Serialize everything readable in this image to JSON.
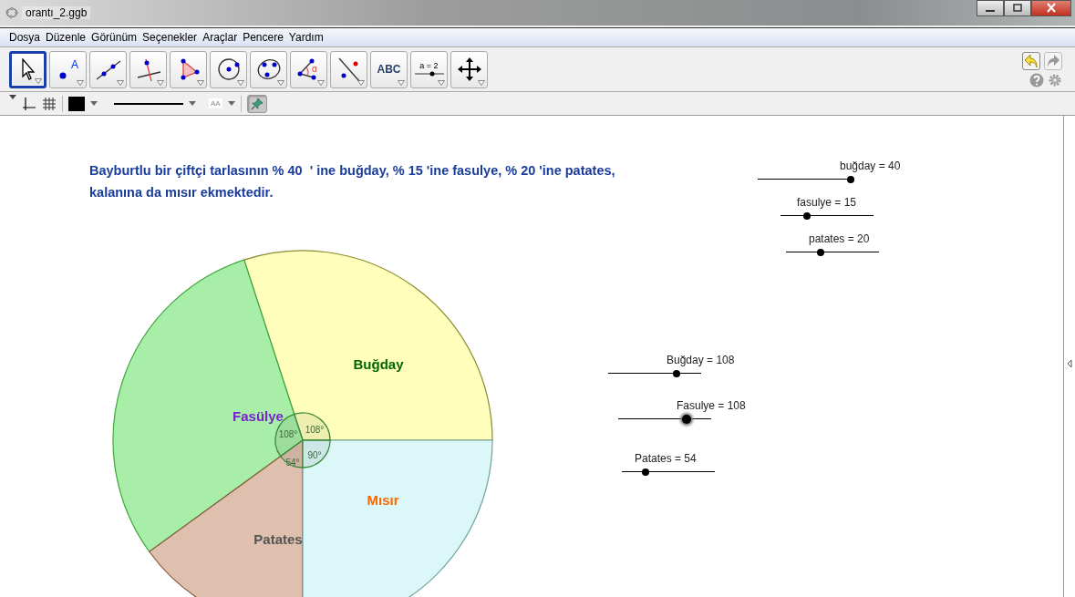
{
  "window": {
    "title": "orantı_2.ggb"
  },
  "menu": [
    "Dosya",
    "Düzenle",
    "Görünüm",
    "Seçenekler",
    "Araçlar",
    "Pencere",
    "Yardım"
  ],
  "tools": [
    {
      "kind": "move",
      "selected": true
    },
    {
      "kind": "point",
      "label": "A",
      "selected": false
    },
    {
      "kind": "line",
      "selected": false
    },
    {
      "kind": "perpendicular",
      "selected": false
    },
    {
      "kind": "polygon",
      "selected": false
    },
    {
      "kind": "circle",
      "selected": false
    },
    {
      "kind": "conic",
      "selected": false
    },
    {
      "kind": "angle",
      "label": "α",
      "selected": false
    },
    {
      "kind": "reflect",
      "selected": false
    },
    {
      "kind": "text",
      "label": "ABC",
      "selected": false
    },
    {
      "kind": "slider",
      "label": "a = 2",
      "selected": false
    },
    {
      "kind": "move-view",
      "selected": false
    }
  ],
  "style_bar": {
    "font_size": "AA",
    "pin": {
      "on": true
    }
  },
  "problem": {
    "lines": [
      "Bayburtlu bir çiftçi tarlasının % 40  ' ine buğday, % 15 'ine fasulye, % 20 'ine patates,",
      "kalanına da mısır ekmektedir."
    ]
  },
  "sliders": [
    {
      "label": "buğday = 40",
      "level": 1.0
    },
    {
      "label": "fasulye = 15",
      "level": 0.28
    },
    {
      "label": "patates = 20",
      "level": 0.37
    },
    {
      "label": "Buğday = 108",
      "level": 0.74
    },
    {
      "label": "Fasulye = 108",
      "level": 0.74,
      "selected": true
    },
    {
      "label": "Patates = 54",
      "level": 0.25
    }
  ],
  "pie": {
    "chart_data": {
      "type": "pie",
      "categories": [
        "Buğday",
        "Fasülye",
        "Patates",
        "Mısır"
      ],
      "series": [
        {
          "values": [
            30,
            30,
            15,
            25
          ],
          "colors": [
            "#ffffbb",
            "#a8eea8",
            "#dfc0ae",
            "#dcf7f7"
          ]
        },
        {
          "values": [
            30,
            30,
            15,
            25
          ],
          "colors": [
            "#eeeeae",
            "#9cdd9c",
            "#cfb2a2",
            "#cde6e6"
          ]
        }
      ],
      "value_labels": [
        "108°",
        "108°",
        "54°",
        "90°"
      ]
    }
  }
}
